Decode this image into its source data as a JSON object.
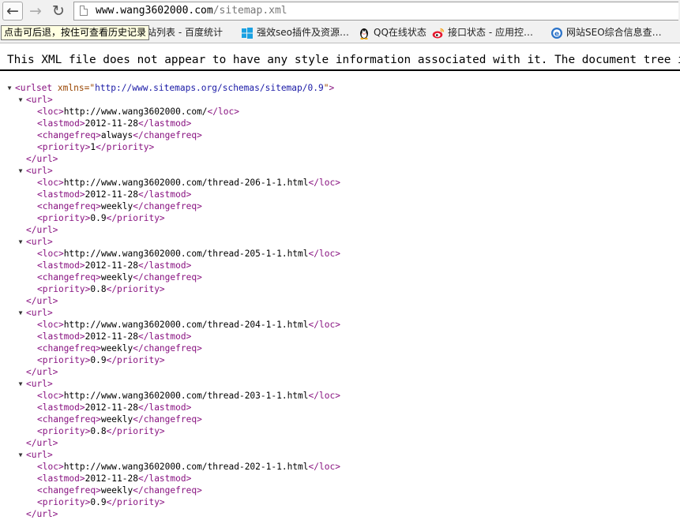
{
  "browser": {
    "url_host": "www.wang3602000.com",
    "url_path": "/sitemap.xml",
    "tooltip": "点击可后退，按住可查看历史记录",
    "bookmarks": [
      {
        "label": "站列表 - 百度统计",
        "icon": "baidu-stats-icon"
      },
      {
        "label": "强效seo插件及资源…",
        "icon": "windows-icon"
      },
      {
        "label": "QQ在线状态",
        "icon": "qq-penguin-icon"
      },
      {
        "label": "接口状态 - 应用控…",
        "icon": "weibo-icon"
      },
      {
        "label": "网站SEO综合信息查…",
        "icon": "ie-globe-icon"
      }
    ]
  },
  "notice": "This XML file does not appear to have any style information associated with it. The document tree is shown below.",
  "xml": {
    "root_tag": "urlset",
    "root_attr_name": "xmlns",
    "root_attr_value": "http://www.sitemaps.org/schemas/sitemap/0.9",
    "entries": [
      {
        "loc": "http://www.wang3602000.com/",
        "lastmod": "2012-11-28",
        "changefreq": "always",
        "priority": "1"
      },
      {
        "loc": "http://www.wang3602000.com/thread-206-1-1.html",
        "lastmod": "2012-11-28",
        "changefreq": "weekly",
        "priority": "0.9"
      },
      {
        "loc": "http://www.wang3602000.com/thread-205-1-1.html",
        "lastmod": "2012-11-28",
        "changefreq": "weekly",
        "priority": "0.8"
      },
      {
        "loc": "http://www.wang3602000.com/thread-204-1-1.html",
        "lastmod": "2012-11-28",
        "changefreq": "weekly",
        "priority": "0.9"
      },
      {
        "loc": "http://www.wang3602000.com/thread-203-1-1.html",
        "lastmod": "2012-11-28",
        "changefreq": "weekly",
        "priority": "0.8"
      },
      {
        "loc": "http://www.wang3602000.com/thread-202-1-1.html",
        "lastmod": "2012-11-28",
        "changefreq": "weekly",
        "priority": "0.9"
      }
    ]
  }
}
